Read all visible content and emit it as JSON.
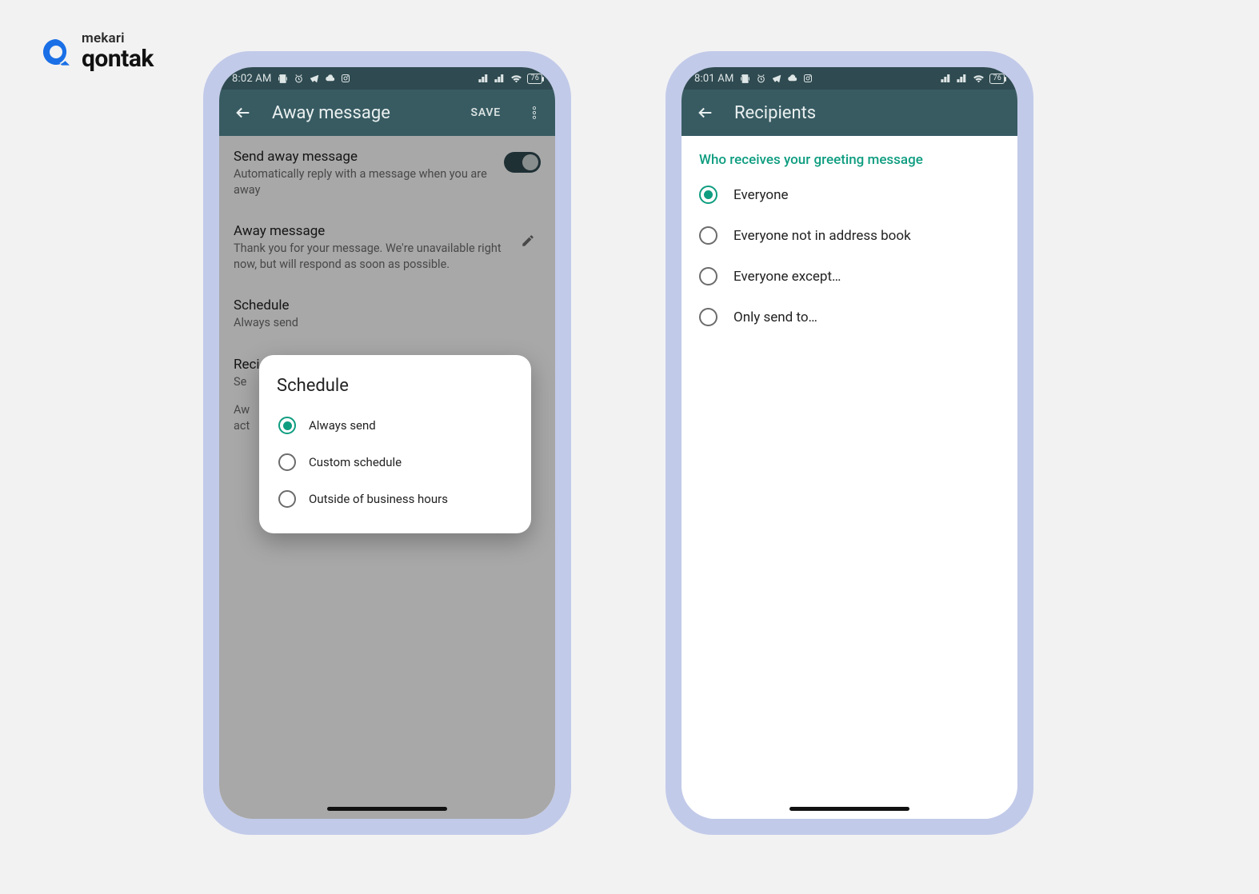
{
  "logo": {
    "top": "mekari",
    "bottom": "qontak"
  },
  "phone1": {
    "statusbar": {
      "time": "8:02 AM",
      "battery": "76"
    },
    "appbar": {
      "title": "Away message",
      "save": "SAVE"
    },
    "rows": {
      "send": {
        "title": "Send away message",
        "sub": "Automatically reply with a message when you are away"
      },
      "msg": {
        "title": "Away message",
        "sub": "Thank you for your message. We're unavailable right now, but will respond as soon as possible."
      },
      "schedule": {
        "title": "Schedule",
        "sub": "Always send"
      },
      "recipients": {
        "title": "Reci",
        "sub": "Se"
      },
      "footer": {
        "l1": "Aw",
        "l2": "act"
      }
    },
    "dialog": {
      "title": "Schedule",
      "options": [
        {
          "label": "Always send",
          "selected": true
        },
        {
          "label": "Custom schedule",
          "selected": false
        },
        {
          "label": "Outside of business hours",
          "selected": false
        }
      ]
    }
  },
  "phone2": {
    "statusbar": {
      "time": "8:01 AM",
      "battery": "76"
    },
    "appbar": {
      "title": "Recipients"
    },
    "header": "Who receives your greeting message",
    "options": [
      {
        "label": "Everyone",
        "selected": true
      },
      {
        "label": "Everyone not in address book",
        "selected": false
      },
      {
        "label": "Everyone except…",
        "selected": false
      },
      {
        "label": "Only send to…",
        "selected": false
      }
    ]
  }
}
